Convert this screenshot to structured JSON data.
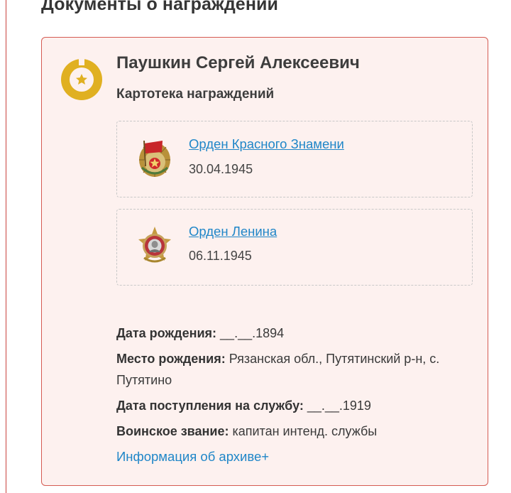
{
  "section": {
    "title": "Документы о награждении"
  },
  "card": {
    "person_name": "Паушкин Сергей Алексеевич",
    "subtitle": "Картотека награждений",
    "badge_icon": "star-badge-icon",
    "awards": [
      {
        "name": "Орден Красного Знамени",
        "date": "30.04.1945",
        "icon": "order-red-banner-icon"
      },
      {
        "name": "Орден Ленина",
        "date": "06.11.1945",
        "icon": "order-lenin-icon"
      }
    ],
    "details": {
      "birth_date_label": "Дата рождения:",
      "birth_date_value": " __.__.1894",
      "birth_place_label": "Место рождения:",
      "birth_place_value": " Рязанская обл., Путятинский р-н, с. Путятино",
      "service_date_label": "Дата поступления на службу:",
      "service_date_value": " __.__.1919",
      "rank_label": "Воинское звание:",
      "rank_value": " капитан интенд. службы"
    },
    "archive_link": "Информация об архиве+"
  },
  "colors": {
    "accent_red": "#d55b52",
    "card_bg": "#fdf1ef",
    "link_blue": "#1f86c8",
    "badge_gold": "#e0b021"
  }
}
